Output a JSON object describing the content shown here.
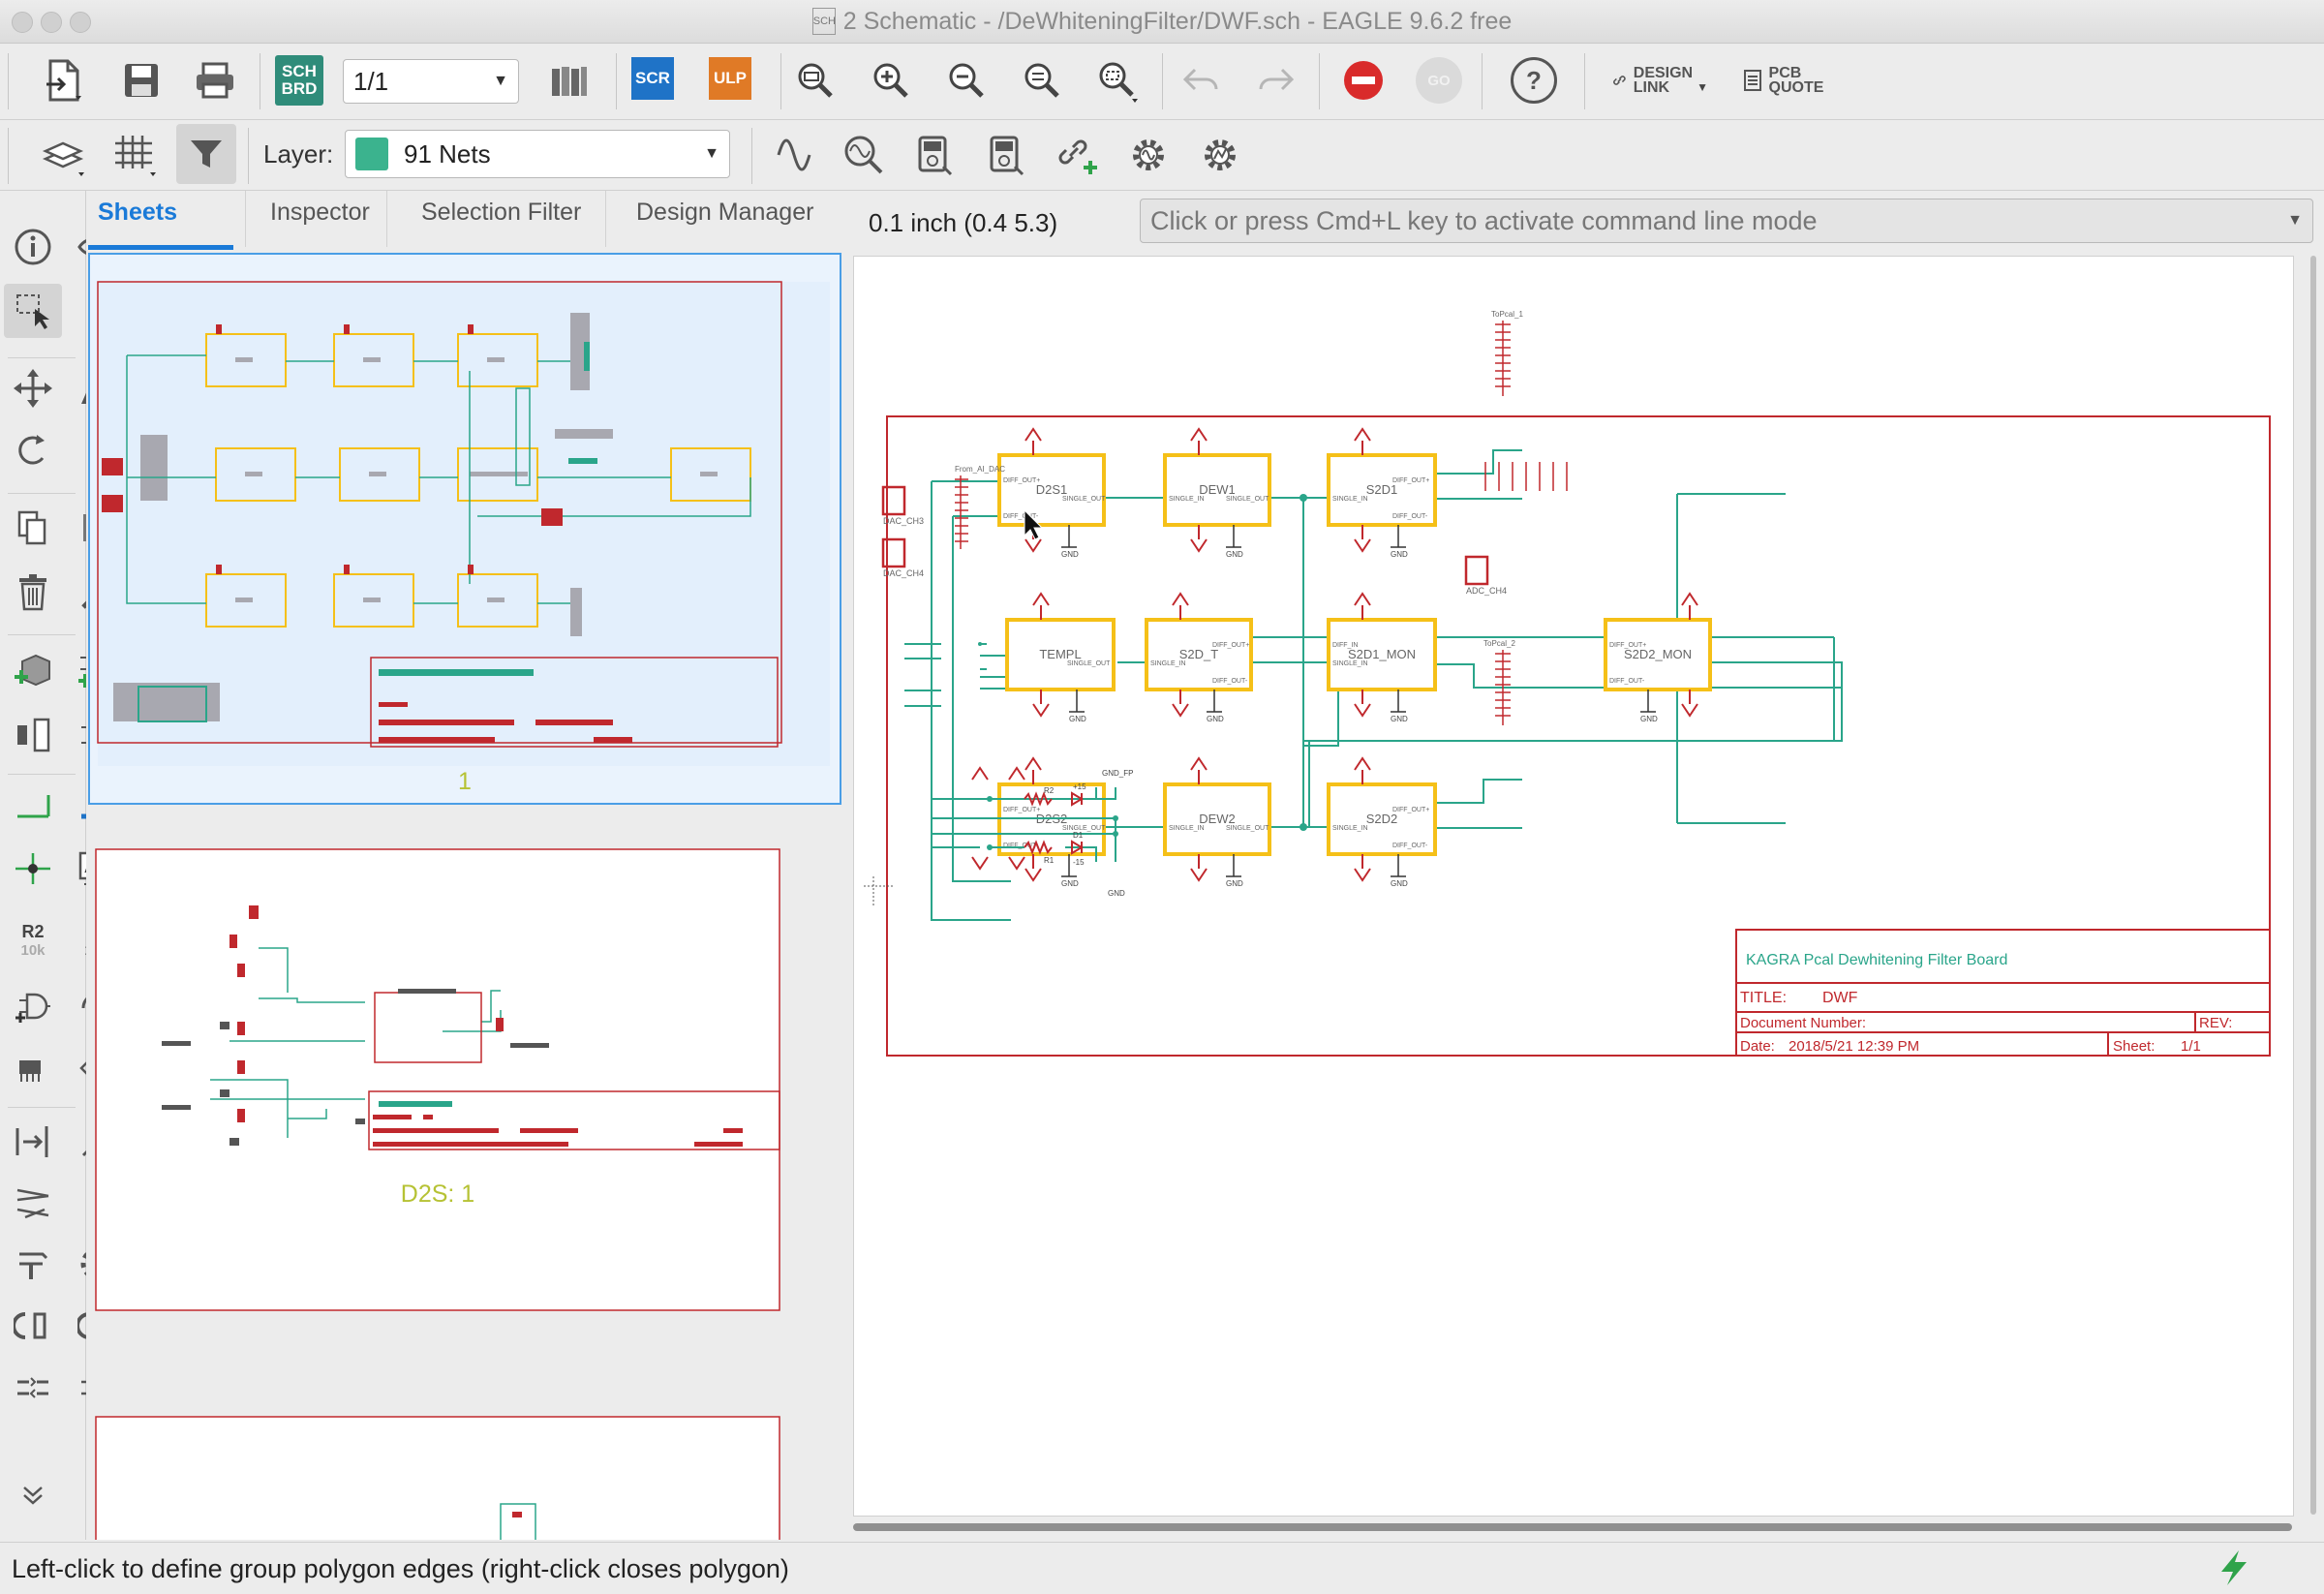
{
  "window": {
    "title": "2 Schematic - /DeWhiteningFilter/DWF.sch - EAGLE 9.6.2 free",
    "doc_badge": "SCH"
  },
  "toolbar": {
    "sch_brd_top": "SCH",
    "sch_brd_bottom": "BRD",
    "sheet_select": "1/1",
    "scr_label": "SCR",
    "ulp_label": "ULP",
    "go_label": "GO",
    "help_label": "?",
    "design_link_top": "DESIGN",
    "design_link_bottom": "LINK",
    "pcb_quote_top": "PCB",
    "pcb_quote_bottom": "QUOTE",
    "layer_label": "Layer:",
    "layer_value": "91 Nets",
    "layer_color": "#3bb38e"
  },
  "left_tools": {
    "r2_label": "R2",
    "r2_value": "10k"
  },
  "tabs": [
    {
      "label": "Sheets",
      "active": true
    },
    {
      "label": "Inspector"
    },
    {
      "label": "Selection Filter"
    },
    {
      "label": "Design Manager"
    }
  ],
  "sheets": [
    {
      "label": "1"
    },
    {
      "label": "D2S: 1"
    }
  ],
  "coordinates": "0.1 inch (0.4 5.3)",
  "command": {
    "placeholder": "Click or press Cmd+L key to activate command line mode"
  },
  "schematic": {
    "blocks": [
      {
        "name": "D2S1"
      },
      {
        "name": "DEW1"
      },
      {
        "name": "S2D1"
      },
      {
        "name": "TEMPL"
      },
      {
        "name": "S2D_T"
      },
      {
        "name": "S2D1_MON"
      },
      {
        "name": "S2D2_MON"
      },
      {
        "name": "D2S2"
      },
      {
        "name": "DEW2"
      },
      {
        "name": "S2D2"
      }
    ],
    "connectors": [
      "DAC_CH3",
      "DAC_CH4",
      "ADC_CH4"
    ],
    "header_labels": [
      "ToPcal_1",
      "ToPcal_2",
      "From_AI_DAC"
    ],
    "pin_labels": {
      "diff_out_p": "DIFF_OUT+",
      "diff_out_n": "DIFF_OUT-",
      "single_out": "SINGLE_OUT",
      "single_in": "SINGLE_IN",
      "diff_in": "DIFF_IN",
      "gnd": "GND",
      "gnd_fp": "GND_FP",
      "p15": "+15",
      "n15": "-15",
      "r1": "R1",
      "r2": "R2",
      "d1": "D1"
    },
    "title_block": {
      "board_title": "KAGRA Pcal Dewhitening Filter Board",
      "title_label": "TITLE:",
      "title_value": "DWF",
      "docnum_label": "Document Number:",
      "rev_label": "REV:",
      "date_label": "Date:",
      "date_value": "2018/5/21 12:39 PM",
      "sheet_label": "Sheet:",
      "sheet_value": "1/1"
    }
  },
  "status": {
    "message": "Left-click to define group polygon edges (right-click closes polygon)"
  },
  "colors": {
    "frame": "#c0282d",
    "part": "#f5c018",
    "net": "#2aa58a",
    "active_tab": "#1a7ad8"
  }
}
